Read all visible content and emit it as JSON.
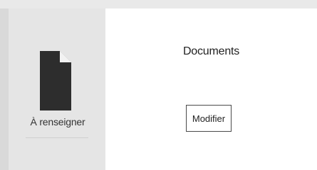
{
  "sidebar": {
    "icon": "document-icon",
    "status_label": "À renseigner"
  },
  "main": {
    "title": "Documents",
    "edit_button_label": "Modifier"
  },
  "colors": {
    "sidebar_bg": "#e5e5e5",
    "icon": "#2d2d2d",
    "text": "#222222",
    "button_border": "#4a4a4a"
  }
}
